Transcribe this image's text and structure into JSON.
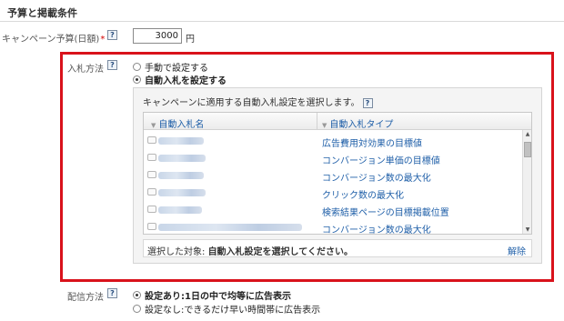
{
  "section": {
    "title": "予算と掲載条件"
  },
  "budget": {
    "label": "キャンペーン予算(日額)",
    "required_mark": "*",
    "value": "3000",
    "unit": "円",
    "help_icon": "?"
  },
  "bid_strategy": {
    "label": "入札方法",
    "help_icon": "?",
    "options": [
      {
        "label": "手動で設定する",
        "selected": false
      },
      {
        "label": "自動入札を設定する",
        "selected": true
      }
    ],
    "panel": {
      "hint": "キャンペーンに適用する自動入札設定を選択します。",
      "help_icon": "?",
      "columns": [
        {
          "label": "自動入札名",
          "sort": "▼"
        },
        {
          "label": "自動入札タイプ",
          "sort": "▼"
        }
      ],
      "rows": [
        {
          "type": "広告費用対効果の目標値"
        },
        {
          "type": "コンバージョン単価の目標値"
        },
        {
          "type": "コンバージョン数の最大化"
        },
        {
          "type": "クリック数の最大化"
        },
        {
          "type": "検索結果ページの目標掲載位置"
        },
        {
          "type": "コンバージョン数の最大化"
        }
      ],
      "selected_label": "選択した対象:",
      "selected_value": "自動入札設定を選択してください。",
      "clear_label": "解除"
    }
  },
  "delivery": {
    "label": "配信方法",
    "help_icon": "?",
    "options": [
      {
        "label": "設定あり:1日の中で均等に広告表示",
        "selected": true
      },
      {
        "label": "設定なし:できるだけ早い時間帯に広告表示",
        "selected": false
      }
    ]
  },
  "colors": {
    "highlight_border": "#d9121b",
    "link": "#1f5fa8"
  }
}
